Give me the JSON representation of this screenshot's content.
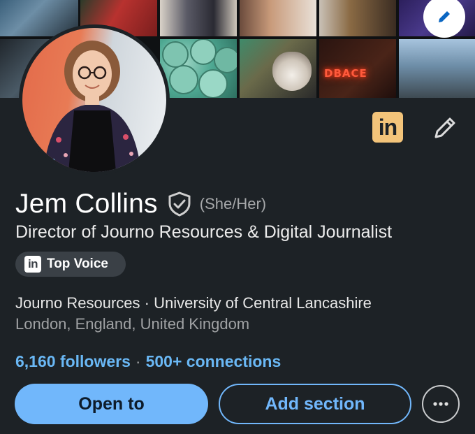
{
  "banner": {
    "tiles": [
      {
        "name": "banner-photo-team"
      },
      {
        "name": "banner-photo-red"
      },
      {
        "name": "banner-photo-group"
      },
      {
        "name": "banner-photo-office"
      },
      {
        "name": "banner-photo-person"
      },
      {
        "name": "banner-photo-award"
      },
      {
        "name": "banner-photo-stage"
      },
      {
        "name": "banner-photo-badges"
      },
      {
        "name": "banner-photo-cat"
      },
      {
        "name": "banner-photo-neon"
      },
      {
        "name": "banner-photo-portrait"
      }
    ],
    "neon_text": "DBACE",
    "edit_icon": "pencil-icon"
  },
  "profile": {
    "name": "Jem Collins",
    "verified_icon": "verified-shield-icon",
    "pronouns": "(She/Her)",
    "headline": "Director of Journo Resources & Digital Journalist",
    "top_voice": {
      "icon_text": "in",
      "label": "Top Voice"
    },
    "orgs": "Journo Resources · University of Central Lancashire",
    "location": "London, England, United Kingdom"
  },
  "actions": {
    "linkedin_icon_text": "in",
    "edit_icon": "pencil-icon"
  },
  "network": {
    "followers": "6,160 followers",
    "separator": "·",
    "connections": "500+ connections"
  },
  "buttons": {
    "open_to": "Open to",
    "add_section": "Add section",
    "more_icon": "ellipsis-icon"
  },
  "colors": {
    "background": "#1d2226",
    "primary": "#71b7fb",
    "link": "#6ab8f5",
    "linkedin_badge": "#f3c47a"
  }
}
